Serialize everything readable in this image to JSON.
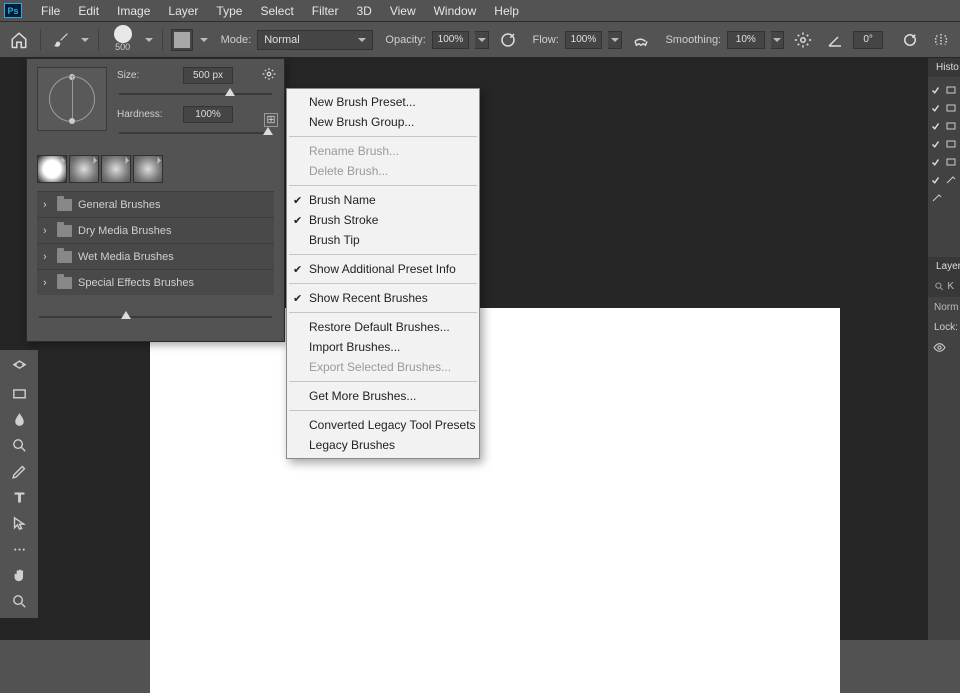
{
  "menubar": [
    "File",
    "Edit",
    "Image",
    "Layer",
    "Type",
    "Select",
    "Filter",
    "3D",
    "View",
    "Window",
    "Help"
  ],
  "options": {
    "brush_size_label": "500",
    "mode_label": "Mode:",
    "mode_value": "Normal",
    "opacity_label": "Opacity:",
    "opacity_value": "100%",
    "flow_label": "Flow:",
    "flow_value": "100%",
    "smoothing_label": "Smoothing:",
    "smoothing_value": "10%",
    "angle_value": "0°"
  },
  "brush_popover": {
    "size_label": "Size:",
    "size_value": "500 px",
    "hardness_label": "Hardness:",
    "hardness_value": "100%",
    "folders": [
      "General Brushes",
      "Dry Media Brushes",
      "Wet Media Brushes",
      "Special Effects Brushes"
    ]
  },
  "context_menu": {
    "items": [
      {
        "label": "New Brush Preset...",
        "enabled": true
      },
      {
        "label": "New Brush Group...",
        "enabled": true
      },
      {
        "sep": true
      },
      {
        "label": "Rename Brush...",
        "enabled": false
      },
      {
        "label": "Delete Brush...",
        "enabled": false
      },
      {
        "sep": true
      },
      {
        "label": "Brush Name",
        "enabled": true,
        "checked": true
      },
      {
        "label": "Brush Stroke",
        "enabled": true,
        "checked": true
      },
      {
        "label": "Brush Tip",
        "enabled": true
      },
      {
        "sep": true
      },
      {
        "label": "Show Additional Preset Info",
        "enabled": true,
        "checked": true
      },
      {
        "sep": true
      },
      {
        "label": "Show Recent Brushes",
        "enabled": true,
        "checked": true
      },
      {
        "sep": true
      },
      {
        "label": "Restore Default Brushes...",
        "enabled": true
      },
      {
        "label": "Import Brushes...",
        "enabled": true
      },
      {
        "label": "Export Selected Brushes...",
        "enabled": false
      },
      {
        "sep": true
      },
      {
        "label": "Get More Brushes...",
        "enabled": true
      },
      {
        "sep": true
      },
      {
        "label": "Converted Legacy Tool Presets",
        "enabled": true
      },
      {
        "label": "Legacy Brushes",
        "enabled": true
      }
    ]
  },
  "right": {
    "history_label": "Histo",
    "layers_label": "Layer",
    "kind_placeholder": "K",
    "norm": "Norm",
    "lock": "Lock:",
    "search_placeholder": ""
  }
}
